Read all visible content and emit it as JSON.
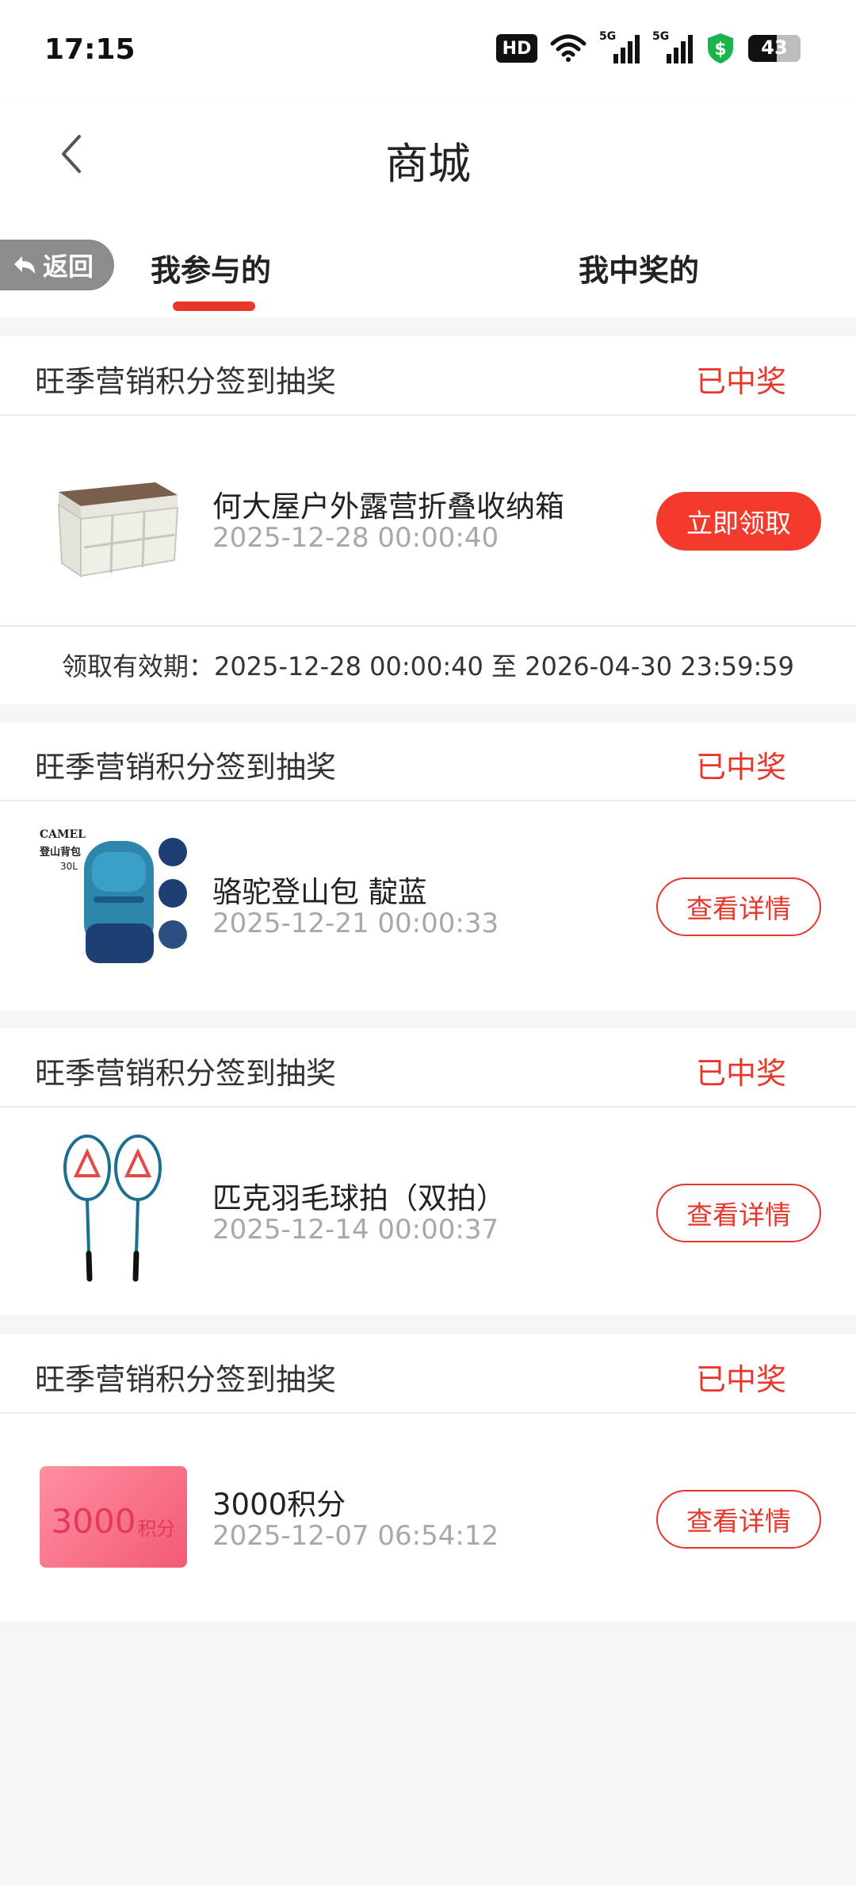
{
  "status_bar": {
    "time": "17:15",
    "hd_label": "HD",
    "signal1_label": "5G",
    "signal2_label": "5G",
    "battery": "43",
    "icons": [
      "hd-icon",
      "wifi-icon",
      "signal-5g-icon",
      "signal-5g-icon",
      "security-shield-icon",
      "battery-icon"
    ]
  },
  "header": {
    "title": "商城",
    "back_icon": "chevron-left-icon"
  },
  "tabs": {
    "return_label": "返回",
    "items": [
      {
        "label": "我参与的",
        "active": true
      },
      {
        "label": "我中奖的",
        "active": false
      }
    ],
    "accent": "#e8362b"
  },
  "records": [
    {
      "campaign": "旺季营销积分签到抽奖",
      "status": "已中奖",
      "prize": "何大屋户外露营折叠收纳箱",
      "time": "2025-12-28 00:00:40",
      "action": "立即领取",
      "action_style": "primary",
      "validity": "领取有效期：2025-12-28 00:00:40 至 2026-04-30 23:59:59"
    },
    {
      "campaign": "旺季营销积分签到抽奖",
      "status": "已中奖",
      "prize": "骆驼登山包 靛蓝",
      "time": "2025-12-21 00:00:33",
      "action": "查看详情",
      "action_style": "outline",
      "thumb_text": {
        "brand": "CAMEL",
        "title": "登山背包",
        "size": "30L"
      }
    },
    {
      "campaign": "旺季营销积分签到抽奖",
      "status": "已中奖",
      "prize": "匹克羽毛球拍（双拍）",
      "time": "2025-12-14 00:00:37",
      "action": "查看详情",
      "action_style": "outline"
    },
    {
      "campaign": "旺季营销积分签到抽奖",
      "status": "已中奖",
      "prize": "3000积分",
      "time": "2025-12-07 06:54:12",
      "action": "查看详情",
      "action_style": "outline",
      "thumb_text": {
        "amount": "3000",
        "unit": "积分"
      }
    }
  ]
}
